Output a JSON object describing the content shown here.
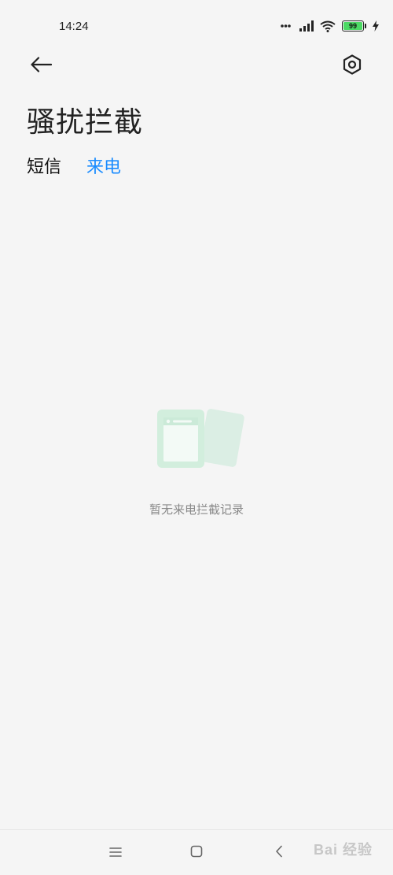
{
  "status_bar": {
    "time": "14:24",
    "battery_level": "99",
    "battery_color": "#4cd964",
    "icons": [
      "signal-dots-icon",
      "cellular-signal-icon",
      "wifi-icon",
      "battery-icon",
      "charging-icon"
    ]
  },
  "header": {
    "back_icon": "arrow-left-icon",
    "settings_icon": "hexagon-gear-icon",
    "title": "骚扰拦截"
  },
  "tabs": [
    {
      "label": "短信",
      "active": false
    },
    {
      "label": "来电",
      "active": true
    }
  ],
  "accent_color": "#1a8cff",
  "empty_state": {
    "icon": "empty-records-illustration",
    "message": "暂无来电拦截记录"
  },
  "nav_bar": {
    "menu_icon": "menu-lines-icon",
    "home_icon": "home-square-icon",
    "back_icon": "chevron-left-icon"
  },
  "watermark": "Bai 经验"
}
